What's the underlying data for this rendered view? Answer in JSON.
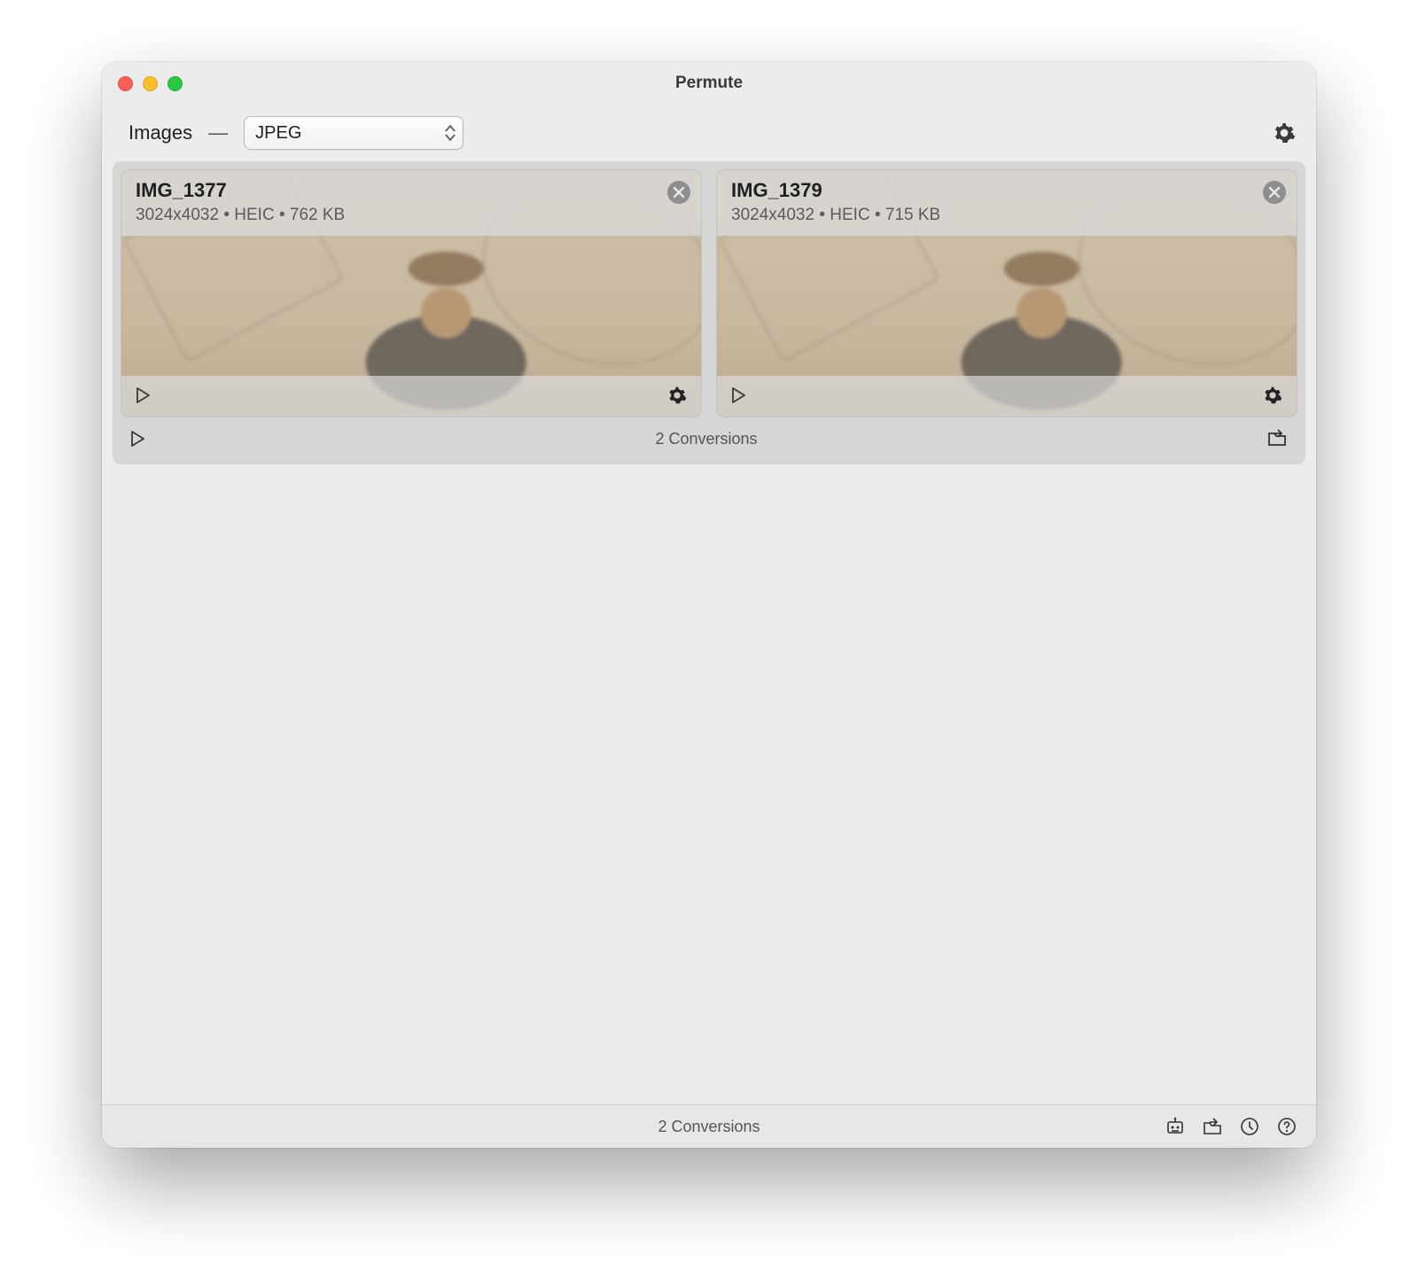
{
  "window": {
    "title": "Permute"
  },
  "toolbar": {
    "category": "Images",
    "separator": "—",
    "format_selected": "JPEG"
  },
  "group": {
    "conversions_label": "2 Conversions"
  },
  "items": [
    {
      "name": "IMG_1377",
      "dimensions": "3024x4032",
      "format": "HEIC",
      "size": "762 KB",
      "sep": " • "
    },
    {
      "name": "IMG_1379",
      "dimensions": "3024x4032",
      "format": "HEIC",
      "size": "715 KB",
      "sep": " • "
    }
  ],
  "statusbar": {
    "label": "2 Conversions"
  }
}
